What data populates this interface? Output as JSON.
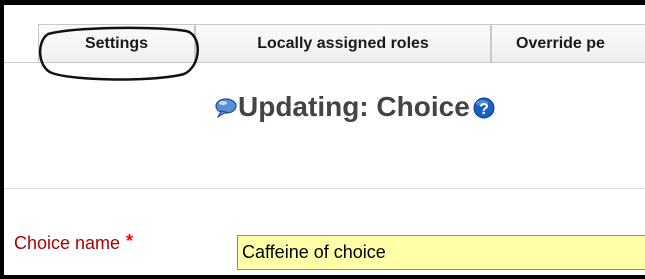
{
  "tabs": [
    {
      "label": "Settings"
    },
    {
      "label": "Locally assigned roles"
    },
    {
      "label": "Override pe"
    }
  ],
  "heading": {
    "title": "Updating: Choice"
  },
  "form": {
    "choice_name_label": "Choice name",
    "required_marker": "*",
    "choice_name_value": "Caffeine of choice"
  },
  "icons": {
    "heading_left": "speech-bubble-icon",
    "heading_right": "help-icon"
  },
  "colors": {
    "label_red": "#aa0000",
    "required_red": "#ff0000",
    "input_highlight": "#ffffa8",
    "help_blue": "#1a5fc4"
  }
}
